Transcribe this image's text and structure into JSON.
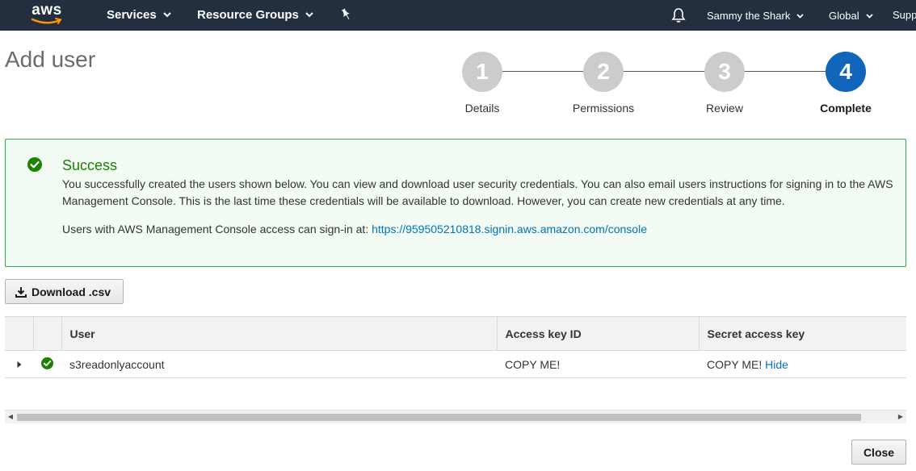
{
  "topbar": {
    "logo_text": "aws",
    "services_label": "Services",
    "resource_groups_label": "Resource Groups",
    "user_label": "Sammy the Shark",
    "region_label": "Global",
    "support_label": "Support"
  },
  "page": {
    "title": "Add user"
  },
  "steps": [
    {
      "number": "1",
      "label": "Details",
      "active": false
    },
    {
      "number": "2",
      "label": "Permissions",
      "active": false
    },
    {
      "number": "3",
      "label": "Review",
      "active": false
    },
    {
      "number": "4",
      "label": "Complete",
      "active": true
    }
  ],
  "success": {
    "title": "Success",
    "message": "You successfully created the users shown below. You can view and download user security credentials. You can also email users instructions for signing in to the AWS Management Console. This is the last time these credentials will be available to download. However, you can create new credentials at any time.",
    "signin_prefix": "Users with AWS Management Console access can sign-in at: ",
    "signin_url": "https://959505210818.signin.aws.amazon.com/console"
  },
  "actions": {
    "download_label": "Download .csv",
    "close_label": "Close"
  },
  "table": {
    "columns": [
      "User",
      "Access key ID",
      "Secret access key"
    ],
    "rows": [
      {
        "user": "s3readonlyaccount",
        "access_key_id": "COPY ME!",
        "secret_access_key": "COPY ME!",
        "hide_label": "Hide"
      }
    ]
  },
  "colors": {
    "topbar": "#232f3e",
    "step_active": "#1166bb",
    "step_inactive": "#cccccc",
    "success_border": "#2eaa47",
    "success_background": "#f2fbf4",
    "link": "#0073bb"
  }
}
